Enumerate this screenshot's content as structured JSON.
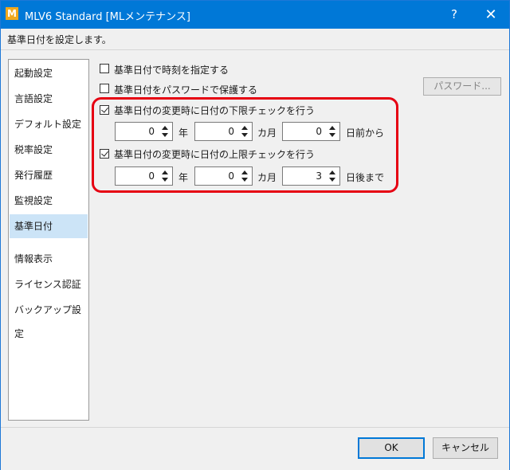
{
  "window": {
    "title": "MLV6 Standard [MLメンテナンス]",
    "icon_letter": "M"
  },
  "titlebar": {
    "help_label": "?",
    "close_label": "✕"
  },
  "subheader": {
    "text": "基準日付を設定します。"
  },
  "sidebar": {
    "items": [
      {
        "label": "起動設定"
      },
      {
        "label": "言語設定"
      },
      {
        "label": "デフォルト設定"
      },
      {
        "label": "税率設定"
      },
      {
        "label": "発行履歴"
      },
      {
        "label": "監視設定"
      },
      {
        "label": "基準日付",
        "selected": true
      },
      {
        "label": "情報表示"
      },
      {
        "label": "ライセンス認証"
      },
      {
        "label": "バックアップ設定"
      }
    ]
  },
  "options": {
    "specify_time": {
      "label": "基準日付で時刻を指定する",
      "checked": false
    },
    "password_protect": {
      "label": "基準日付をパスワードで保護する",
      "checked": false
    },
    "password_button": "パスワード...",
    "lower_check": {
      "label": "基準日付の変更時に日付の下限チェックを行う",
      "checked": true,
      "year": "0",
      "year_unit": "年",
      "month": "0",
      "month_unit": "カ月",
      "day": "0",
      "day_unit": "日前から"
    },
    "upper_check": {
      "label": "基準日付の変更時に日付の上限チェックを行う",
      "checked": true,
      "year": "0",
      "year_unit": "年",
      "month": "0",
      "month_unit": "カ月",
      "day": "3",
      "day_unit": "日後まで"
    }
  },
  "footer": {
    "ok_label": "OK",
    "cancel_label": "キャンセル"
  },
  "colors": {
    "titlebar": "#0078d7",
    "highlight": "#e60012",
    "selected_item": "#cce4f7",
    "app_icon": "#f0a81c"
  }
}
